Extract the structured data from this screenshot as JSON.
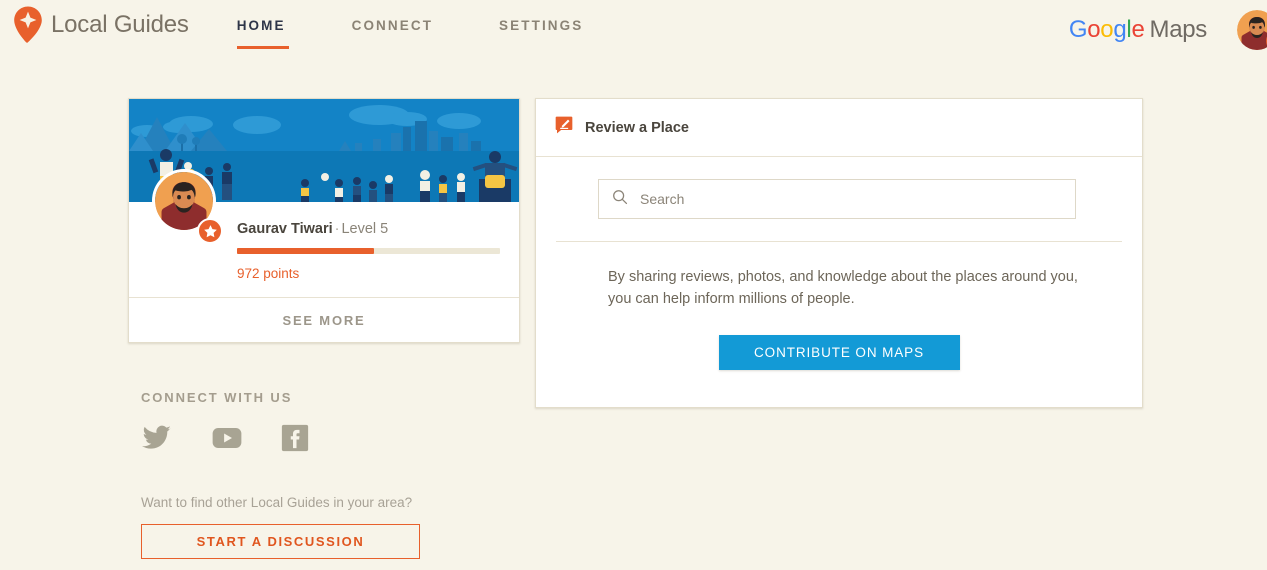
{
  "header": {
    "brand_name": "Local Guides",
    "logo_icon": "map-pin-star-icon",
    "nav": [
      {
        "label": "HOME",
        "active": true
      },
      {
        "label": "CONNECT",
        "active": false
      },
      {
        "label": "SETTINGS",
        "active": false
      }
    ],
    "google_maps_logo": {
      "letters": [
        "G",
        "o",
        "o",
        "g",
        "l",
        "e"
      ],
      "word": "Maps",
      "colors": [
        "#4285f4",
        "#ea4335",
        "#fbbc05",
        "#4285f4",
        "#34a853",
        "#ea4335"
      ],
      "maps_color": "#6f6a63"
    },
    "avatar_icon": "user-avatar",
    "avatar_badge_icon": "star-badge-icon"
  },
  "profile": {
    "banner_icon": "local-guides-community-illustration",
    "avatar_icon": "user-avatar",
    "avatar_badge_icon": "star-badge-icon",
    "name": "Gaurav Tiwari",
    "separator": "·",
    "level": "Level 5",
    "points": "972 points",
    "progress_percent": 52,
    "see_more_label": "SEE MORE"
  },
  "connect": {
    "title": "CONNECT WITH US",
    "socials": [
      {
        "name": "twitter-icon",
        "label": "Twitter"
      },
      {
        "name": "youtube-icon",
        "label": "YouTube"
      },
      {
        "name": "facebook-icon",
        "label": "Facebook"
      }
    ]
  },
  "discussion": {
    "prompt": "Want to find other Local Guides in your area?",
    "button_label": "START A DISCUSSION"
  },
  "review_card": {
    "icon": "review-pencil-bubble-icon",
    "title": "Review a Place",
    "search": {
      "icon": "search-icon",
      "placeholder": "Search",
      "value": ""
    },
    "blurb_line1": "By sharing reviews, photos, and knowledge about the places around you,",
    "blurb_line2": "you can help inform millions of people.",
    "cta_label": "CONTRIBUTE ON MAPS"
  },
  "colors": {
    "background": "#f7f4e9",
    "accent_orange": "#e8602c",
    "accent_blue": "#139ad6",
    "banner_blue": "#1383c6",
    "card_white": "#ffffff",
    "border": "#e3ddcb",
    "text_dark": "#4a453d",
    "text_muted": "#a8a296"
  }
}
